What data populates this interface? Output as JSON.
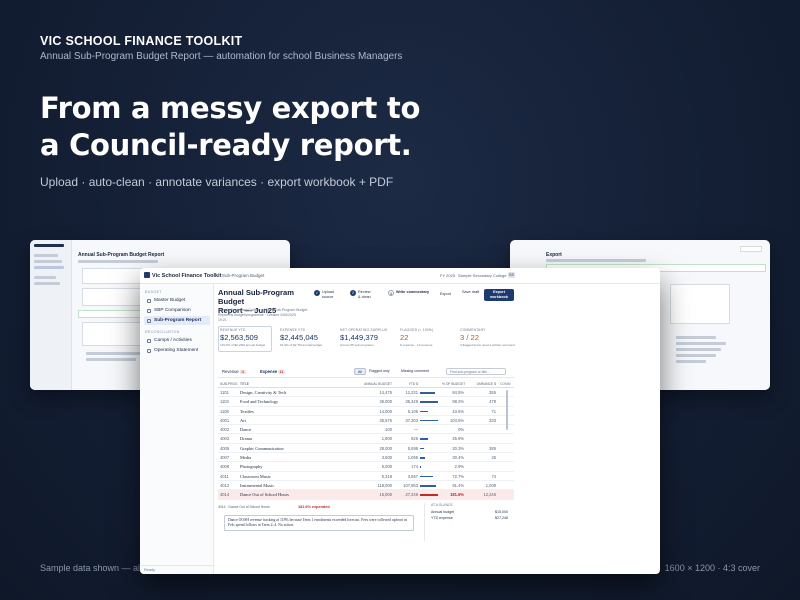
{
  "brand": {
    "name": "VIC SCHOOL FINANCE TOOLKIT",
    "subtitle": "Annual Sub-Program Budget Report — automation for school Business Managers"
  },
  "headline": {
    "line1": "From a messy export to",
    "line2": "a Council-ready report."
  },
  "tagline": "Upload · auto-clean · annotate variances · export workbook + PDF",
  "footer": {
    "left": "Sample data shown — all",
    "right": "1600 × 1200 · 4:3 cover"
  },
  "side_cards": {
    "left_title": "Annual Sub-Program Budget Report",
    "right_title": "Export"
  },
  "app": {
    "logo": "Vic School Finance Toolkit",
    "crumb": "Sub-Program Budget",
    "fy": "FY 2025",
    "school": "Sample Secondary College",
    "avatar": "SS",
    "sidebar": {
      "section1": "BUDGET",
      "items": [
        {
          "label": "Master Budget",
          "active": false
        },
        {
          "label": "SBP Comparison",
          "active": false
        },
        {
          "label": "Sub-Program Report",
          "active": true
        }
      ],
      "section2": "RECONCILIATION",
      "items2": [
        {
          "label": "Camps / Activities"
        },
        {
          "label": "Operating Statement"
        }
      ],
      "status": "Ready"
    },
    "report": {
      "title_line1": "Annual Sub-Program Budget",
      "title_line2": "Report — Jun25",
      "meta1": "Sample Secondary College · 1234 · Sub-Program Budget",
      "meta2": "Report by budget/programme · Created 2/06/2025",
      "meta3": "19:21"
    },
    "steps": [
      {
        "num": "✓",
        "label": "Upload",
        "sub": "source"
      },
      {
        "num": "2",
        "label": "Review",
        "sub": "& clean"
      },
      {
        "num": "3",
        "label": "Write commentary",
        "sub": ""
      }
    ],
    "actions": {
      "export": "Export",
      "save": "Save draft",
      "primary": "Export workbook"
    },
    "kpis": [
      {
        "label": "REVENUE YTD",
        "value": "$2,563,509",
        "sub": "115.0% of $2.23M annual budget",
        "warn": false
      },
      {
        "label": "EXPENSE YTD",
        "value": "$2,445,045",
        "sub": "91.9% of $2.7M annual budget",
        "warn": false
      },
      {
        "label": "NET OPERATING SURPLUS",
        "value": "$1,449,379",
        "sub": "Across 55 sub-programs",
        "warn": false
      },
      {
        "label": "FLAGGED (> 100%)",
        "value": "22",
        "sub": "8 expense · 14 revenue",
        "warn": true
      },
      {
        "label": "COMMENTARY",
        "value": "3 / 22",
        "sub": "3 flagged items need a written comment",
        "warn": true
      }
    ],
    "filters": {
      "revenue": "Revenue",
      "revenue_count": "11",
      "expense": "Expense",
      "expense_count": "11",
      "all": "All",
      "flagged": "Flagged only",
      "missing": "Missing comment",
      "search_placeholder": "Find sub-program or title…"
    },
    "table": {
      "headers": {
        "code": "SUB-PROG",
        "title": "TITLE",
        "annual": "ANNUAL BUDGET",
        "ytd": "YTD $",
        "pct": "% OF BUDGET",
        "var": "VARIANCE $",
        "com": "COMM"
      },
      "rows": [
        {
          "code": "1101",
          "title": "Design, Creativity & Tech",
          "annual": "14,475",
          "ytd": "12,231",
          "pct": "84.5%",
          "var": "355",
          "frac": 0.845,
          "flag": false
        },
        {
          "code": "1103",
          "title": "Food and Technology",
          "annual": "36,000",
          "ytd": "35,349",
          "pct": "98.2%",
          "var": "478",
          "frac": 0.982,
          "flag": false
        },
        {
          "code": "1108",
          "title": "Textiles",
          "annual": "14,000",
          "ytd": "6,106",
          "pct": "43.6%",
          "var": "71",
          "frac": 0.436,
          "flag": false
        },
        {
          "code": "4001",
          "title": "Art",
          "annual": "35,675",
          "ytd": "37,303",
          "pct": "104.6%",
          "var": "333",
          "frac": 1.0,
          "flag": false
        },
        {
          "code": "4002",
          "title": "Dance",
          "annual": "100",
          "ytd": "—",
          "pct": "0%",
          "var": "",
          "frac": 0.0,
          "flag": false
        },
        {
          "code": "4003",
          "title": "Drama",
          "annual": "1,800",
          "ytd": "826",
          "pct": "45.9%",
          "var": "",
          "frac": 0.459,
          "flag": false
        },
        {
          "code": "4005",
          "title": "Graphic Communication",
          "annual": "28,000",
          "ytd": "5,695",
          "pct": "20.3%",
          "var": "385",
          "frac": 0.203,
          "flag": false
        },
        {
          "code": "4007",
          "title": "Media",
          "annual": "3,500",
          "ytd": "1,065",
          "pct": "30.4%",
          "var": "25",
          "frac": 0.304,
          "flag": false
        },
        {
          "code": "4008",
          "title": "Photography",
          "annual": "6,000",
          "ytd": "174",
          "pct": "2.9%",
          "var": "",
          "frac": 0.029,
          "flag": false
        },
        {
          "code": "4011",
          "title": "Classroom Music",
          "annual": "5,319",
          "ytd": "3,867",
          "pct": "72.7%",
          "var": "74",
          "frac": 0.727,
          "flag": false
        },
        {
          "code": "4012",
          "title": "Instrumental Music",
          "annual": "118,000",
          "ytd": "107,853",
          "pct": "91.4%",
          "var": "1,009",
          "frac": 0.914,
          "flag": false
        },
        {
          "code": "4014",
          "title": "Dance Out of School Hours",
          "annual": "15,000",
          "ytd": "27,246",
          "pct": "181.6%",
          "var": "12,246",
          "frac": 1.0,
          "flag": true
        }
      ]
    },
    "detail": {
      "bar_text": "4014 · Dance Out of School Hours",
      "warning": "181.6% expended",
      "note": "Dance OOSH revenue tracking at 118% because Term 1 enrolments exceeded forecast. Fees were collected upfront in Feb; spend follows in Term 2–4. No action.",
      "glance_title": "AT A GLANCE",
      "glance_rows": [
        {
          "k": "Annual budget",
          "v": "$15,000"
        },
        {
          "k": "YTD expense",
          "v": "$27,246"
        }
      ]
    }
  }
}
